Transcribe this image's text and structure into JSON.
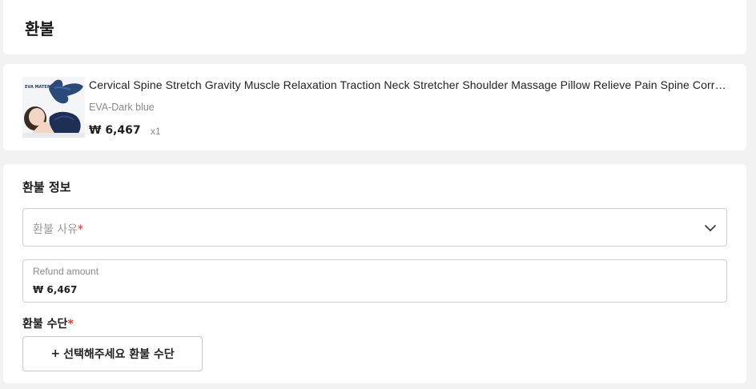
{
  "header": {
    "title": "환불"
  },
  "product": {
    "image": "neck-stretcher-pillow-photo",
    "image_brand_text": "EVA MATERIAL",
    "title": "Cervical Spine Stretch Gravity Muscle Relaxation Traction Neck Stretcher Shoulder Massage Pillow Relieve Pain Spine Correction",
    "variant": "EVA-Dark blue",
    "price": "₩ 6,467",
    "quantity": "x1"
  },
  "refund_info": {
    "section_title": "환불 정보",
    "reason": {
      "placeholder": "환불 사유",
      "required_mark": "*",
      "icon": "chevron-down-icon"
    },
    "amount": {
      "label": "Refund amount",
      "value": "₩ 6,467"
    },
    "method": {
      "label": "환불 수단",
      "required_mark": "*",
      "button_plus": "+",
      "button_label": "선택해주세요 환불 수단"
    }
  },
  "colors": {
    "required": "#e0322c",
    "border": "#d0d0d0",
    "background": "#f2f2f2"
  }
}
